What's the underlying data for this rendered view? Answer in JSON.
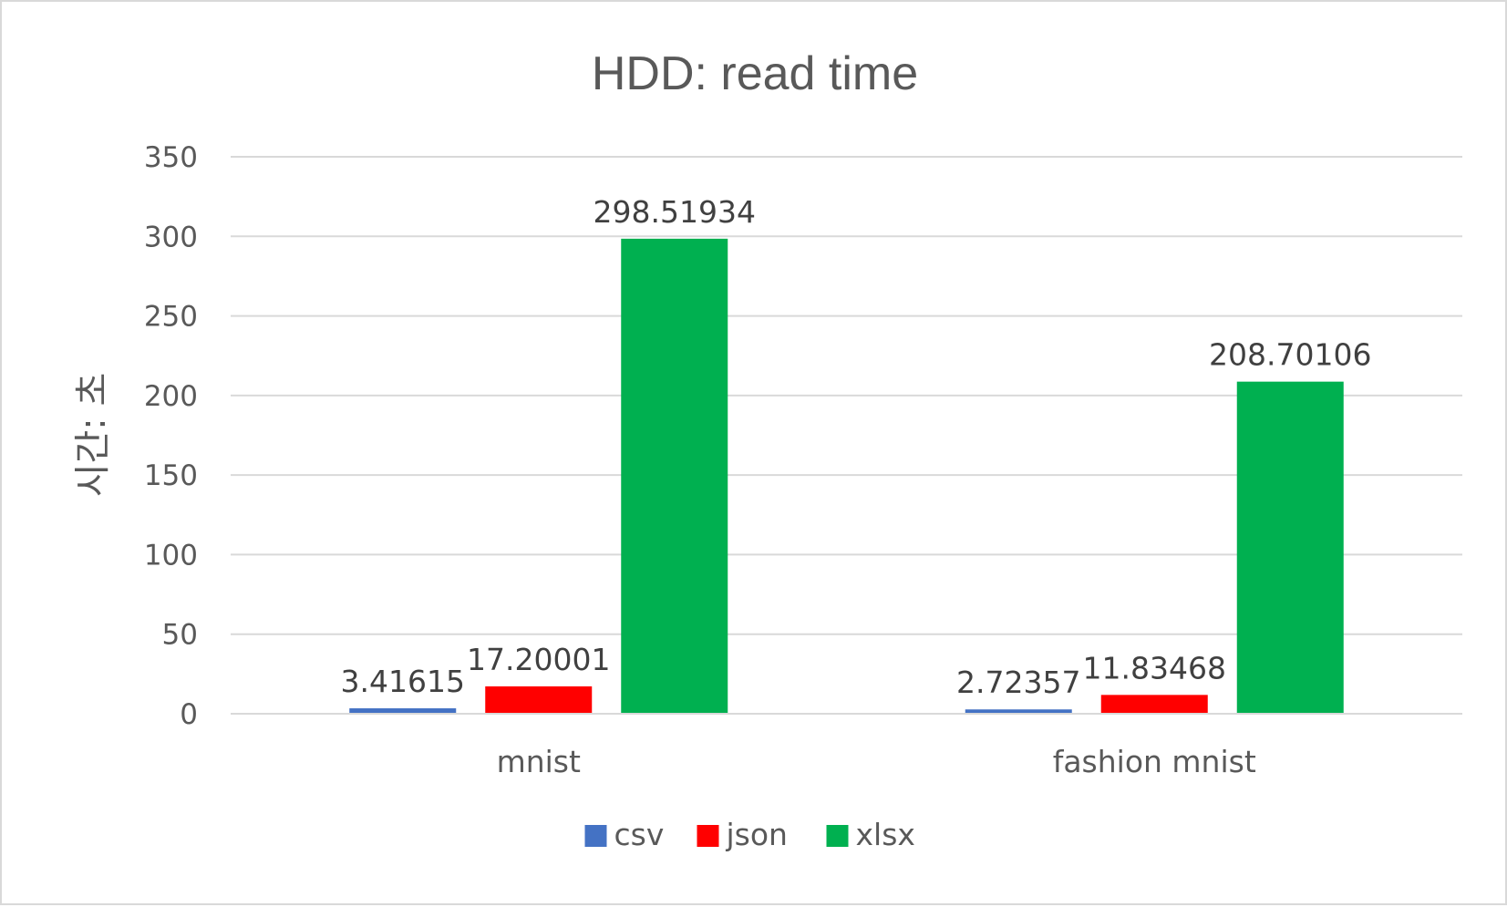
{
  "chart_data": {
    "type": "bar",
    "title": "HDD: read time",
    "xlabel": "",
    "ylabel": "시간: 초",
    "categories": [
      "mnist",
      "fashion mnist"
    ],
    "series": [
      {
        "name": "csv",
        "color": "#4472c4",
        "values": [
          3.41615,
          2.72357
        ],
        "labels": [
          "3.41615",
          "2.72357"
        ]
      },
      {
        "name": "json",
        "color": "#ff0000",
        "values": [
          17.20001,
          11.83468
        ],
        "labels": [
          "17.20001",
          "11.83468"
        ]
      },
      {
        "name": "xlsx",
        "color": "#00b050",
        "values": [
          298.51934,
          208.70106
        ],
        "labels": [
          "298.51934",
          "208.70106"
        ]
      }
    ],
    "ylim": [
      0,
      350
    ],
    "yticks": [
      0,
      50,
      100,
      150,
      200,
      250,
      300,
      350
    ],
    "grid": true,
    "legend_position": "bottom"
  }
}
